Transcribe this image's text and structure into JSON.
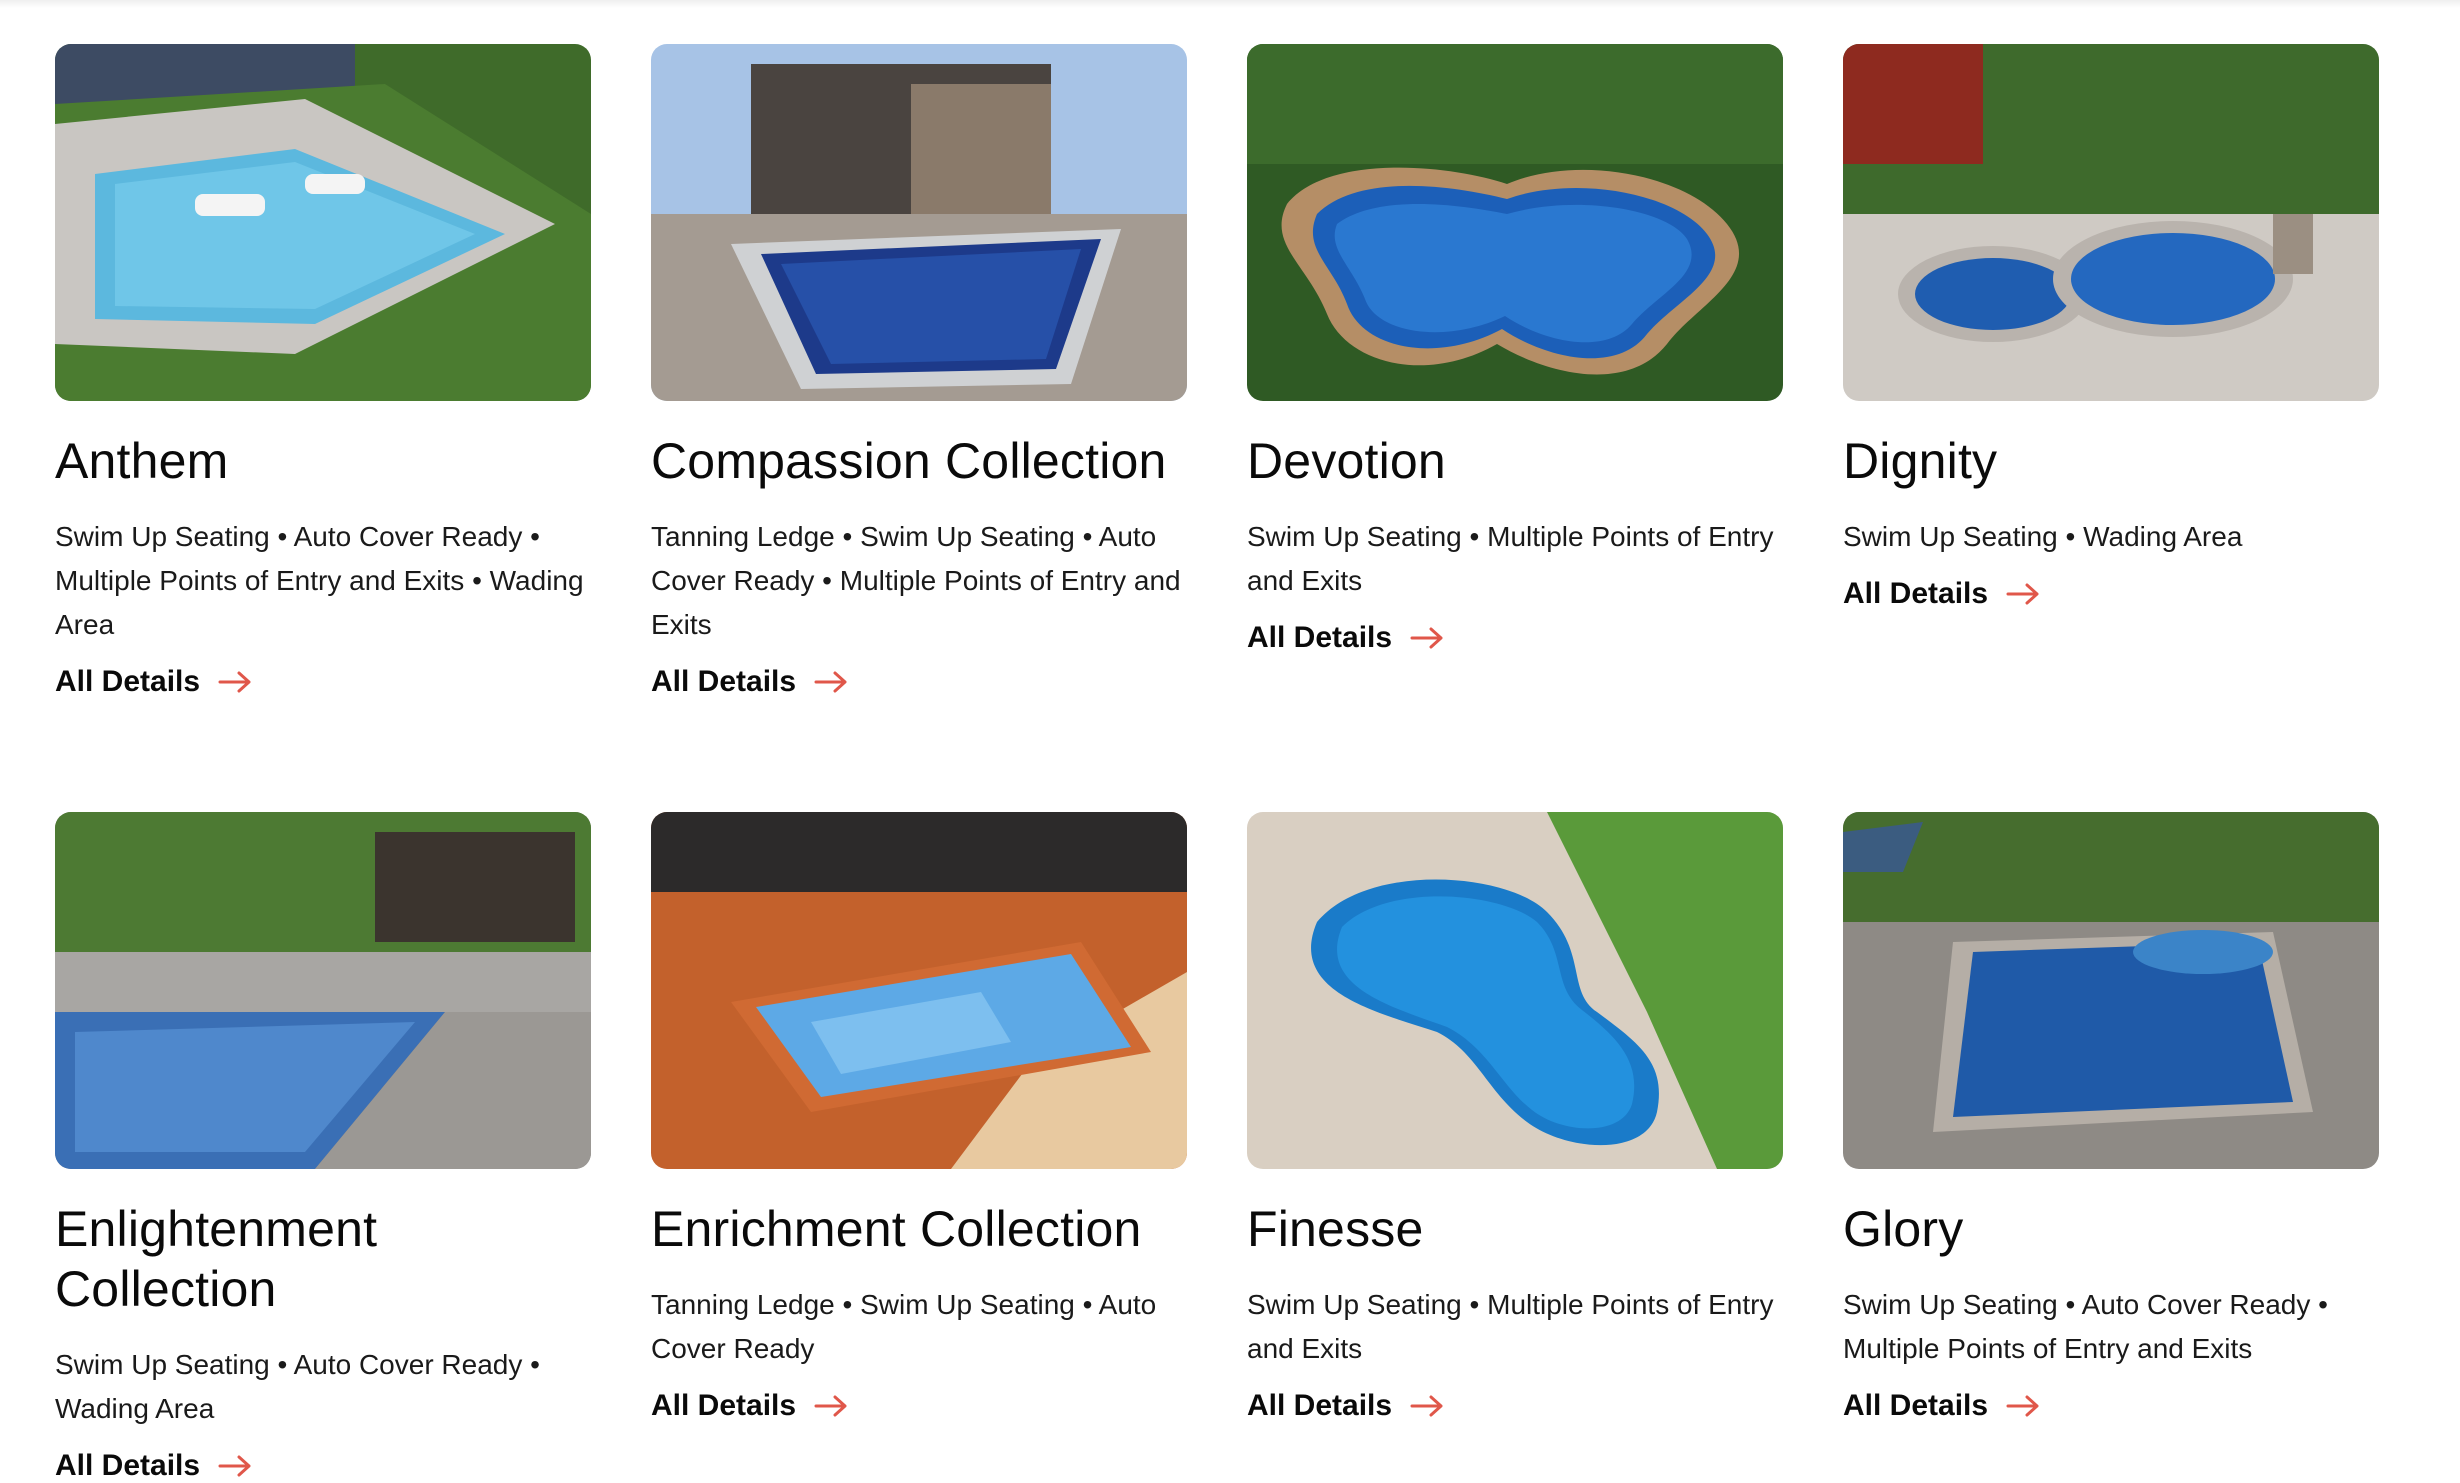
{
  "colors": {
    "arrow": "#e0574a",
    "text": "#111111"
  },
  "cards": [
    {
      "title": "Anthem",
      "features": "Swim Up Seating • Auto Cover Ready • Multiple Points of Entry and Exits • Wading Area",
      "link": "All Details"
    },
    {
      "title": "Compassion Collection",
      "features": "Tanning Ledge • Swim Up Seating • Auto Cover Ready • Multiple Points of Entry and Exits",
      "link": "All Details"
    },
    {
      "title": "Devotion",
      "features": "Swim Up Seating • Multiple Points of Entry and Exits",
      "link": "All Details"
    },
    {
      "title": "Dignity",
      "features": "Swim Up Seating • Wading Area",
      "link": "All Details"
    },
    {
      "title": "Enlightenment Collection",
      "features": "Swim Up Seating • Auto Cover Ready • Wading Area",
      "link": "All Details"
    },
    {
      "title": "Enrichment Collection",
      "features": "Tanning Ledge • Swim Up Seating • Auto Cover Ready",
      "link": "All Details"
    },
    {
      "title": "Finesse",
      "features": "Swim Up Seating • Multiple Points of Entry and Exits",
      "link": "All Details"
    },
    {
      "title": "Glory",
      "features": "Swim Up Seating • Auto Cover Ready • Multiple Points of Entry and Exits",
      "link": "All Details"
    }
  ]
}
